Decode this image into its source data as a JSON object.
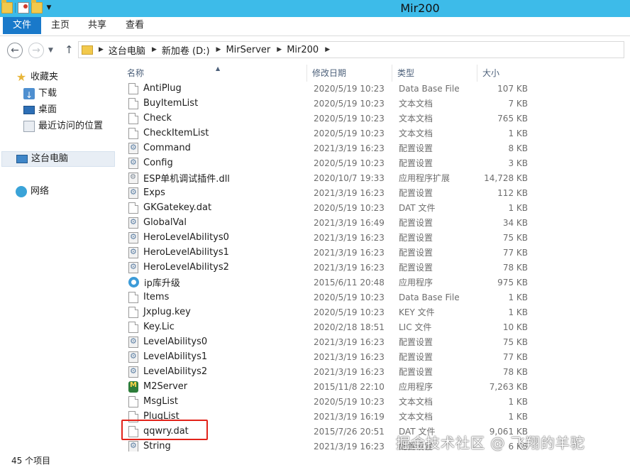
{
  "window": {
    "title": "Mir200"
  },
  "ribbon": {
    "tabs": [
      "文件",
      "主页",
      "共享",
      "查看"
    ]
  },
  "address": {
    "crumbs": [
      "这台电脑",
      "新加卷 (D:)",
      "MirServer",
      "Mir200"
    ]
  },
  "nav_pane": {
    "favorites_label": "收藏夹",
    "favorites": [
      "下载",
      "桌面",
      "最近访问的位置"
    ],
    "this_pc": "这台电脑",
    "network": "网络"
  },
  "columns": {
    "name": "名称",
    "date": "修改日期",
    "type": "类型",
    "size": "大小"
  },
  "files": [
    {
      "name": "AntiPlug",
      "date": "2020/5/19 10:23",
      "type": "Data Base File",
      "size": "107 KB",
      "icon": "document-icon"
    },
    {
      "name": "BuyItemList",
      "date": "2020/5/19 10:23",
      "type": "文本文档",
      "size": "7 KB",
      "icon": "document-icon"
    },
    {
      "name": "Check",
      "date": "2020/5/19 10:23",
      "type": "文本文档",
      "size": "765 KB",
      "icon": "document-icon"
    },
    {
      "name": "CheckItemList",
      "date": "2020/5/19 10:23",
      "type": "文本文档",
      "size": "1 KB",
      "icon": "document-icon"
    },
    {
      "name": "Command",
      "date": "2021/3/19 16:23",
      "type": "配置设置",
      "size": "8 KB",
      "icon": "config-icon"
    },
    {
      "name": "Config",
      "date": "2020/5/19 10:23",
      "type": "配置设置",
      "size": "3 KB",
      "icon": "config-icon"
    },
    {
      "name": "ESP单机调试插件.dll",
      "date": "2020/10/7 19:33",
      "type": "应用程序扩展",
      "size": "14,728 KB",
      "icon": "dll-icon"
    },
    {
      "name": "Exps",
      "date": "2021/3/19 16:23",
      "type": "配置设置",
      "size": "112 KB",
      "icon": "config-icon"
    },
    {
      "name": "GKGatekey.dat",
      "date": "2020/5/19 10:23",
      "type": "DAT 文件",
      "size": "1 KB",
      "icon": "document-icon"
    },
    {
      "name": "GlobalVal",
      "date": "2021/3/19 16:49",
      "type": "配置设置",
      "size": "34 KB",
      "icon": "config-icon"
    },
    {
      "name": "HeroLevelAbilitys0",
      "date": "2021/3/19 16:23",
      "type": "配置设置",
      "size": "75 KB",
      "icon": "config-icon"
    },
    {
      "name": "HeroLevelAbilitys1",
      "date": "2021/3/19 16:23",
      "type": "配置设置",
      "size": "77 KB",
      "icon": "config-icon"
    },
    {
      "name": "HeroLevelAbilitys2",
      "date": "2021/3/19 16:23",
      "type": "配置设置",
      "size": "78 KB",
      "icon": "config-icon"
    },
    {
      "name": "ip库升级",
      "date": "2015/6/11 20:48",
      "type": "应用程序",
      "size": "975 KB",
      "icon": "app-icon"
    },
    {
      "name": "Items",
      "date": "2020/5/19 10:23",
      "type": "Data Base File",
      "size": "1 KB",
      "icon": "document-icon"
    },
    {
      "name": "Jxplug.key",
      "date": "2020/5/19 10:23",
      "type": "KEY 文件",
      "size": "1 KB",
      "icon": "document-icon"
    },
    {
      "name": "Key.Lic",
      "date": "2020/2/18 18:51",
      "type": "LIC 文件",
      "size": "10 KB",
      "icon": "document-icon"
    },
    {
      "name": "LevelAbilitys0",
      "date": "2021/3/19 16:23",
      "type": "配置设置",
      "size": "75 KB",
      "icon": "config-icon"
    },
    {
      "name": "LevelAbilitys1",
      "date": "2021/3/19 16:23",
      "type": "配置设置",
      "size": "77 KB",
      "icon": "config-icon"
    },
    {
      "name": "LevelAbilitys2",
      "date": "2021/3/19 16:23",
      "type": "配置设置",
      "size": "78 KB",
      "icon": "config-icon"
    },
    {
      "name": "M2Server",
      "date": "2015/11/8 22:10",
      "type": "应用程序",
      "size": "7,263 KB",
      "icon": "m2server-icon"
    },
    {
      "name": "MsgList",
      "date": "2020/5/19 10:23",
      "type": "文本文档",
      "size": "1 KB",
      "icon": "document-icon"
    },
    {
      "name": "PlugList",
      "date": "2021/3/19 16:19",
      "type": "文本文档",
      "size": "1 KB",
      "icon": "document-icon"
    },
    {
      "name": "qqwry.dat",
      "date": "2015/7/26 20:51",
      "type": "DAT 文件",
      "size": "9,061 KB",
      "icon": "document-icon"
    },
    {
      "name": "String",
      "date": "2021/3/19 16:23",
      "type": "配置设置",
      "size": "6 KB",
      "icon": "config-icon"
    }
  ],
  "status": {
    "item_count": "45 个项目"
  },
  "watermark": "掘金技术社区 @ 飞翔的羊驼",
  "colors": {
    "titlebar": "#3dbbe9",
    "file_tab": "#1979ca",
    "highlight_box": "#e2231a"
  }
}
